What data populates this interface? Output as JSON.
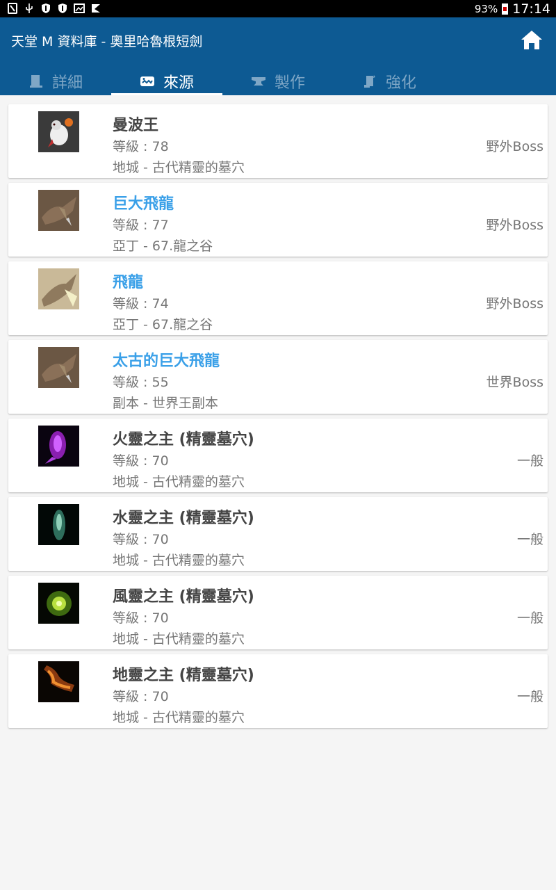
{
  "status": {
    "battery": "93%",
    "time": "17:14"
  },
  "app": {
    "title": "天堂 M 資料庫 - 奧里哈魯根短劍"
  },
  "tabs": [
    {
      "label": "詳細",
      "icon": "document-icon",
      "active": false
    },
    {
      "label": "來源",
      "icon": "monster-icon",
      "active": true
    },
    {
      "label": "製作",
      "icon": "anvil-icon",
      "active": false
    },
    {
      "label": "強化",
      "icon": "scroll-icon",
      "active": false
    }
  ],
  "sources": [
    {
      "name": "曼波王",
      "level": "等級 : 78",
      "location": "地城 - 古代精靈的墓穴",
      "type": "野外Boss",
      "link": false,
      "thumb": "rabbit"
    },
    {
      "name": "巨大飛龍",
      "level": "等級 : 77",
      "location": "亞丁 - 67.龍之谷",
      "type": "野外Boss",
      "link": true,
      "thumb": "dragon"
    },
    {
      "name": "飛龍",
      "level": "等級 : 74",
      "location": "亞丁 - 67.龍之谷",
      "type": "野外Boss",
      "link": true,
      "thumb": "drake"
    },
    {
      "name": "太古的巨大飛龍",
      "level": "等級 : 55",
      "location": "副本 - 世界王副本",
      "type": "世界Boss",
      "link": true,
      "thumb": "dragon"
    },
    {
      "name": "火靈之主 (精靈墓穴)",
      "level": "等級 : 70",
      "location": "地城 - 古代精靈的墓穴",
      "type": "一般",
      "link": false,
      "thumb": "fire"
    },
    {
      "name": "水靈之主 (精靈墓穴)",
      "level": "等級 : 70",
      "location": "地城 - 古代精靈的墓穴",
      "type": "一般",
      "link": false,
      "thumb": "water"
    },
    {
      "name": "風靈之主 (精靈墓穴)",
      "level": "等級 : 70",
      "location": "地城 - 古代精靈的墓穴",
      "type": "一般",
      "link": false,
      "thumb": "wind"
    },
    {
      "name": "地靈之主 (精靈墓穴)",
      "level": "等級 : 70",
      "location": "地城 - 古代精靈的墓穴",
      "type": "一般",
      "link": false,
      "thumb": "earth"
    }
  ],
  "colors": {
    "appbar": "#0d5a93",
    "link": "#3aa0e8",
    "text": "#444444",
    "subtext": "#777777"
  }
}
